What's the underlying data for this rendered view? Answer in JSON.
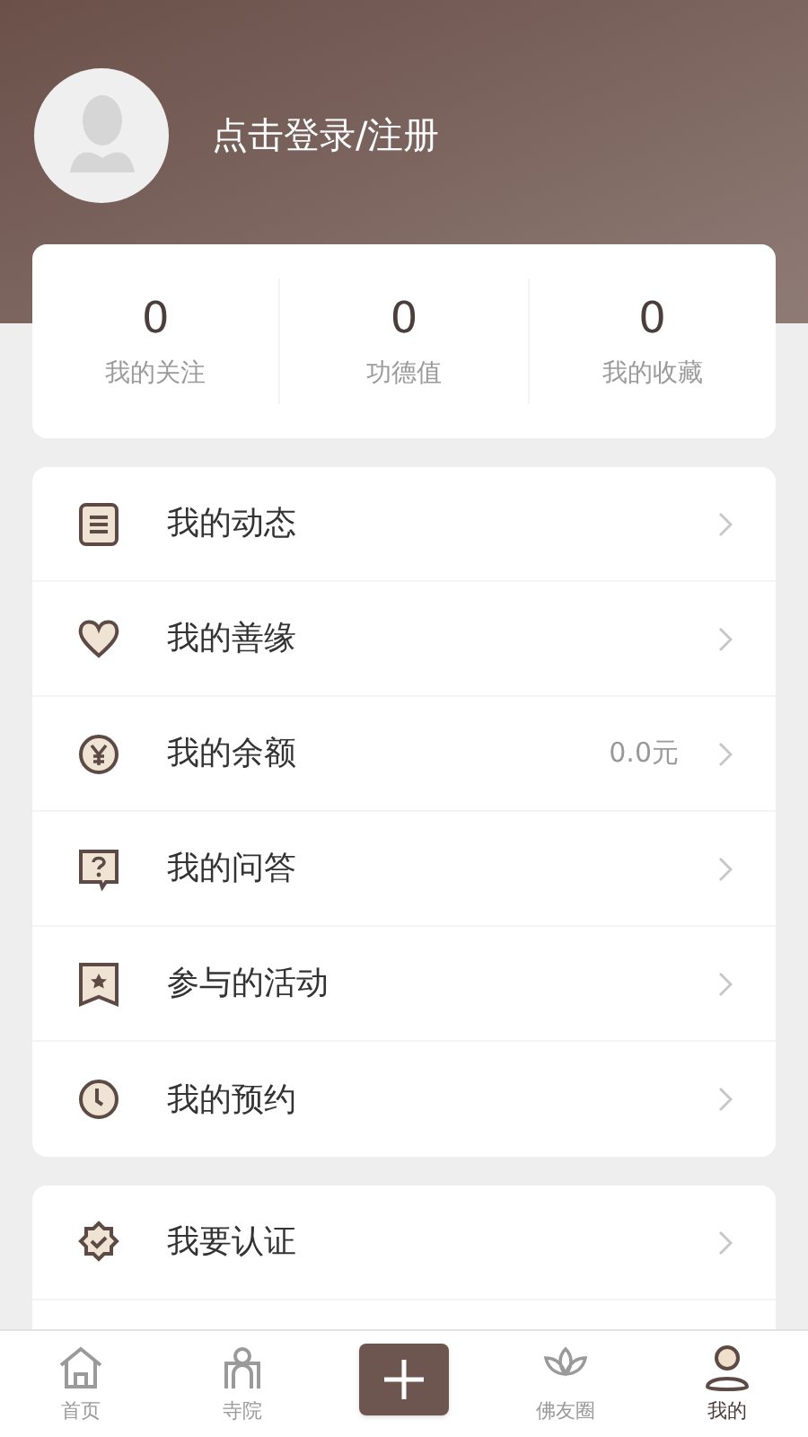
{
  "profile": {
    "login": "点击登录/注册"
  },
  "stats": [
    {
      "value": "0",
      "label": "我的关注"
    },
    {
      "value": "0",
      "label": "功德值"
    },
    {
      "value": "0",
      "label": "我的收藏"
    }
  ],
  "menu": [
    {
      "label": "我的动态"
    },
    {
      "label": "我的善缘"
    },
    {
      "label": "我的余额",
      "value": "0.0元"
    },
    {
      "label": "我的问答"
    },
    {
      "label": "参与的活动"
    },
    {
      "label": "我的预约"
    }
  ],
  "menu2": [
    {
      "label": "我要认证"
    }
  ],
  "tabs": [
    {
      "kind": "tab",
      "label": "首页",
      "selected": false
    },
    {
      "kind": "tab",
      "label": "寺院",
      "selected": false
    },
    {
      "kind": "add"
    },
    {
      "kind": "tab",
      "label": "佛友圈",
      "selected": false
    },
    {
      "kind": "tab",
      "label": "我的",
      "selected": true
    }
  ]
}
